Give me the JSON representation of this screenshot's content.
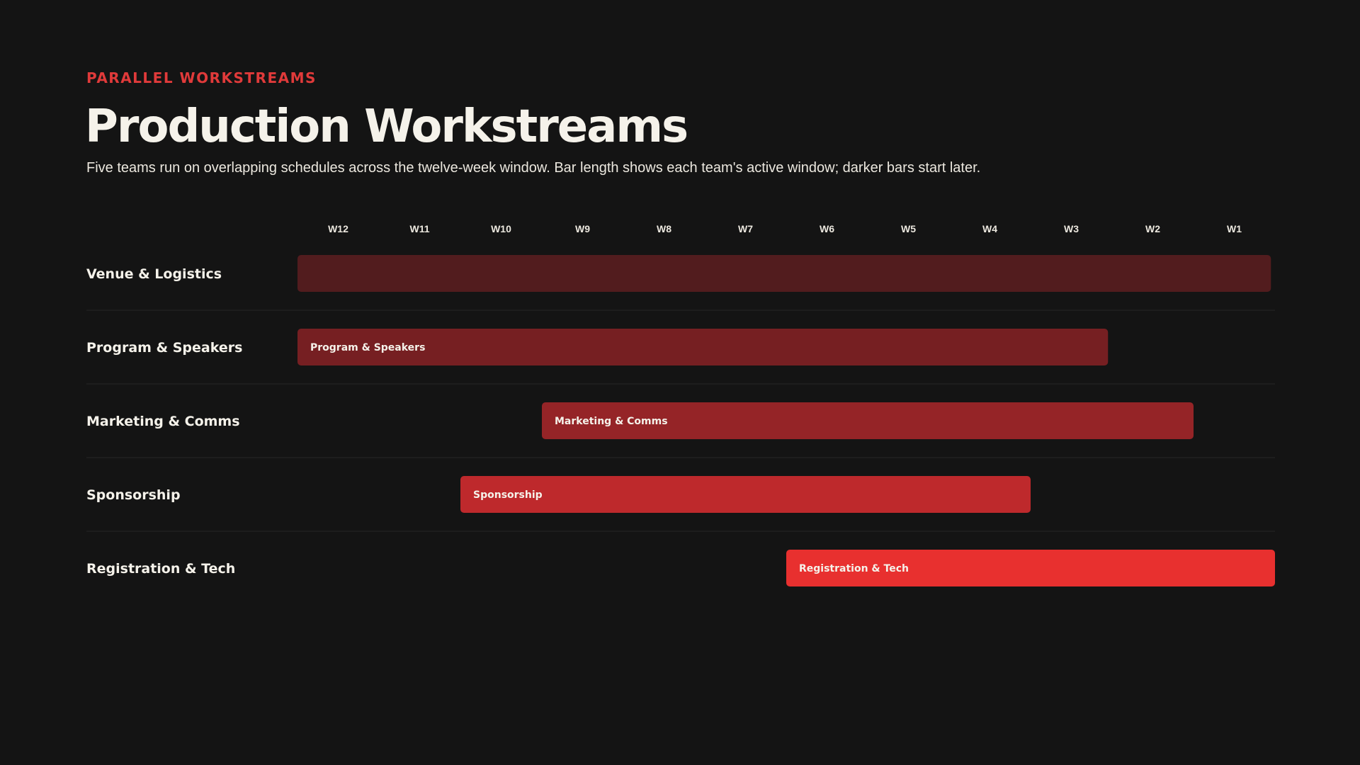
{
  "header": {
    "eyebrow": "PARALLEL WORKSTREAMS",
    "title": "Production Workstreams",
    "subtitle": "Five teams run on overlapping schedules across the twelve-week window. Bar length shows each team's active window; darker bars start later."
  },
  "chart_data": {
    "type": "bar",
    "orientation": "horizontal",
    "gantt": true,
    "title": "",
    "xlabel": "",
    "ylabel": "",
    "weeks": [
      "W12",
      "W11",
      "W10",
      "W9",
      "W8",
      "W7",
      "W6",
      "W5",
      "W4",
      "W3",
      "W2",
      "W1"
    ],
    "x_range": [
      0,
      12
    ],
    "x_unit": "weeks elapsed from W12",
    "grid": false,
    "legend": "none",
    "categories": [
      "Venue & Logistics",
      "Program & Speakers",
      "Marketing & Comms",
      "Sponsorship",
      "Registration & Tech"
    ],
    "series": [
      {
        "values": [
          {
            "start": 0.0,
            "end": 11.95,
            "color": "#521c1e",
            "label": ""
          },
          {
            "start": 0.0,
            "end": 9.95,
            "color": "#761f22",
            "label": "Program & Speakers"
          },
          {
            "start": 3.0,
            "end": 11.0,
            "color": "#952427",
            "label": "Marketing & Comms"
          },
          {
            "start": 2.0,
            "end": 9.0,
            "color": "#be292c",
            "label": "Sponsorship"
          },
          {
            "start": 6.0,
            "end": 12.0,
            "color": "#e8302f",
            "label": "Registration & Tech"
          }
        ]
      }
    ]
  }
}
